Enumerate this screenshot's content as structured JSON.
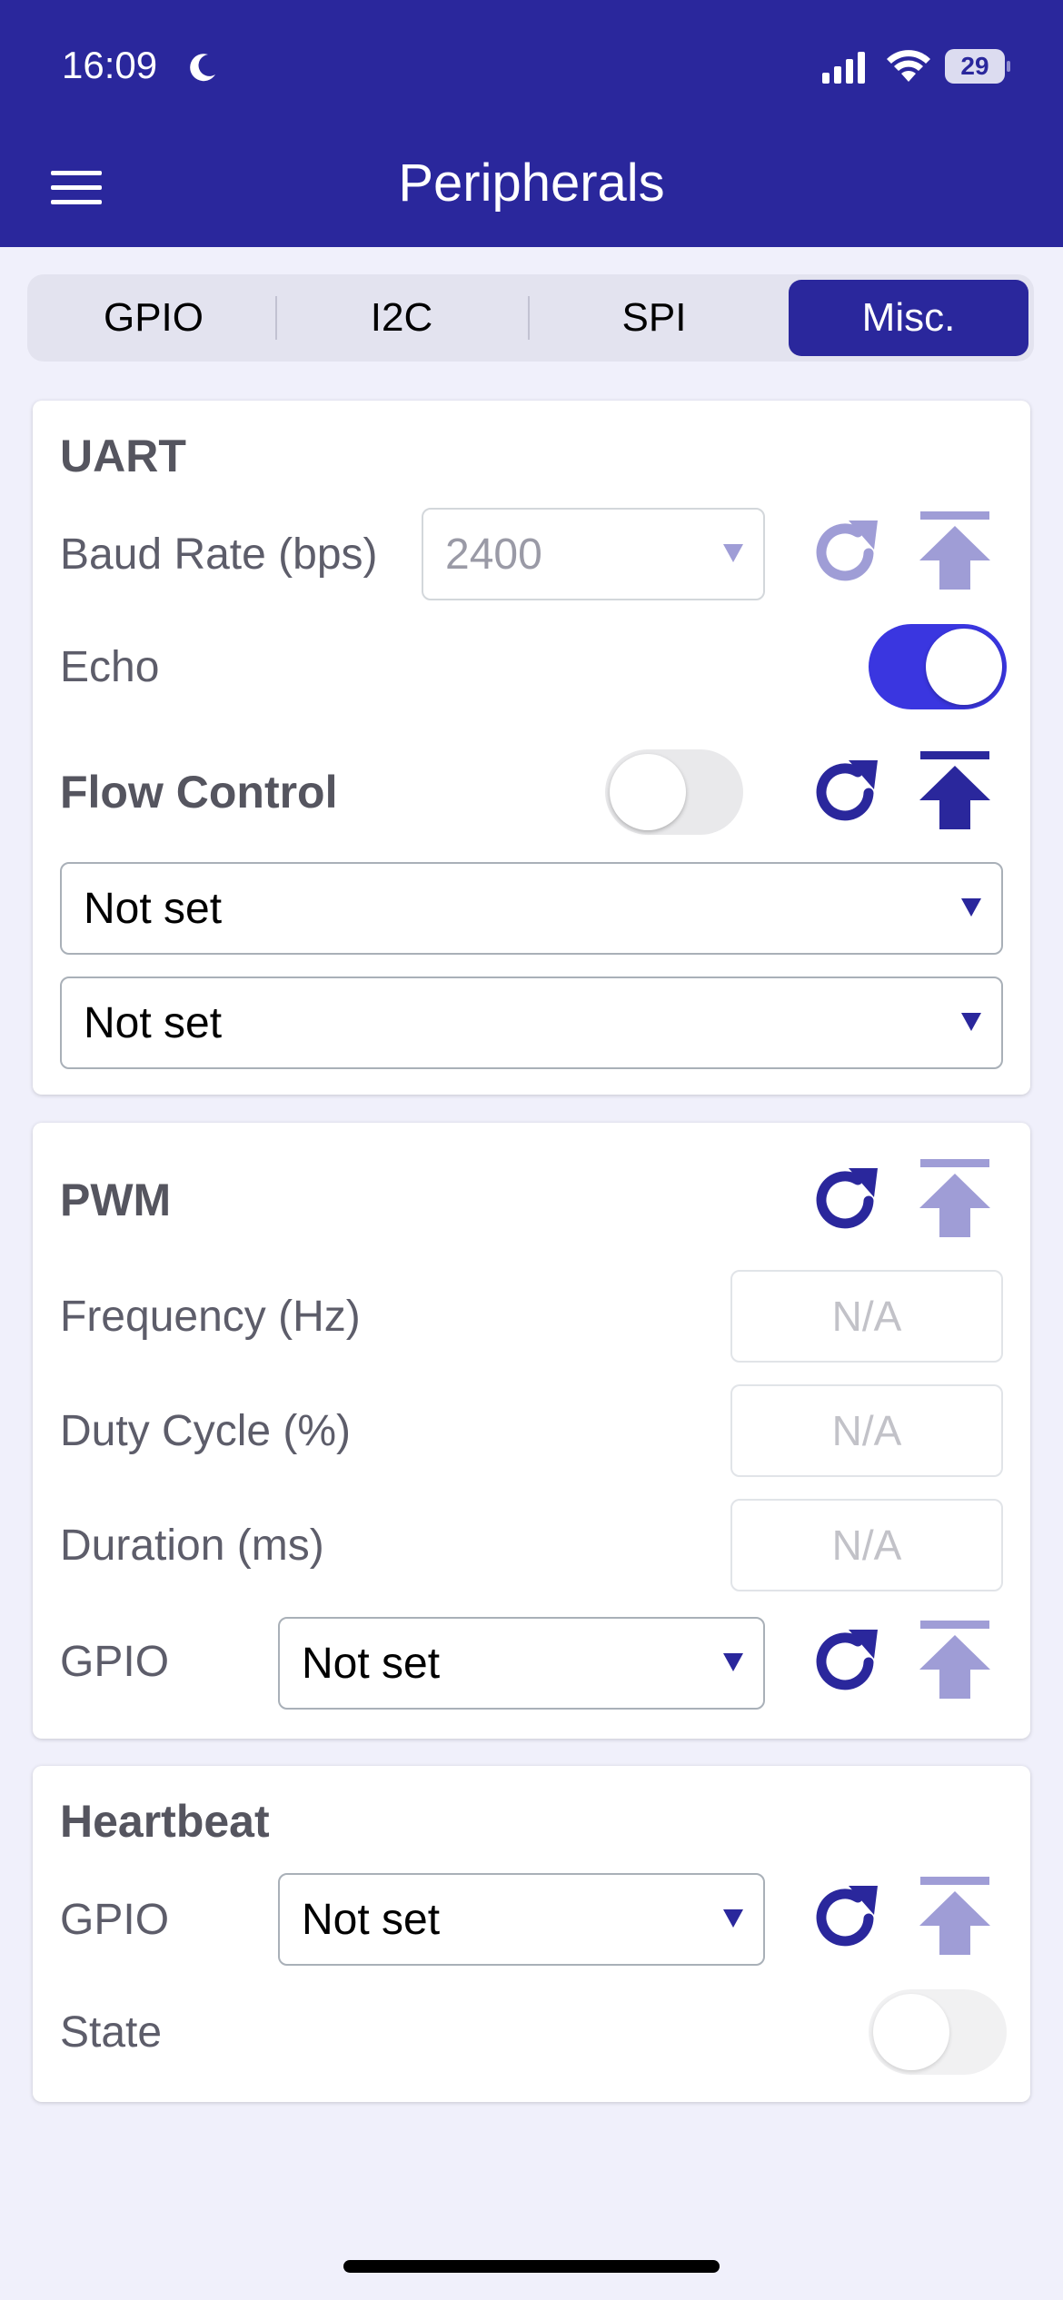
{
  "status_bar": {
    "time": "16:09",
    "battery": "29",
    "icons": [
      "moon-icon",
      "cellular-signal-icon",
      "wifi-icon",
      "battery-icon"
    ]
  },
  "header": {
    "title": "Peripherals",
    "menu_icon": "hamburger-menu-icon"
  },
  "tabs": [
    {
      "label": "GPIO",
      "active": false
    },
    {
      "label": "I2C",
      "active": false
    },
    {
      "label": "SPI",
      "active": false
    },
    {
      "label": "Misc.",
      "active": true
    }
  ],
  "uart": {
    "title": "UART",
    "baud_label": "Baud Rate (bps)",
    "baud_value": "2400",
    "echo_label": "Echo",
    "echo_on": true,
    "flow_label": "Flow Control",
    "flow_on": false,
    "flow_pin_1": "Not set",
    "flow_pin_2": "Not set"
  },
  "pwm": {
    "title": "PWM",
    "frequency_label": "Frequency (Hz)",
    "frequency_value": "N/A",
    "duty_label": "Duty Cycle (%)",
    "duty_value": "N/A",
    "duration_label": "Duration (ms)",
    "duration_value": "N/A",
    "gpio_label": "GPIO",
    "gpio_value": "Not set"
  },
  "heartbeat": {
    "title": "Heartbeat",
    "gpio_label": "GPIO",
    "gpio_value": "Not set",
    "state_label": "State",
    "state_on": false
  },
  "colors": {
    "primary": "#2a279c",
    "toggle_on": "#3a36e0",
    "disabled_icon": "#9f9dd6",
    "background": "#f0f0fb"
  }
}
